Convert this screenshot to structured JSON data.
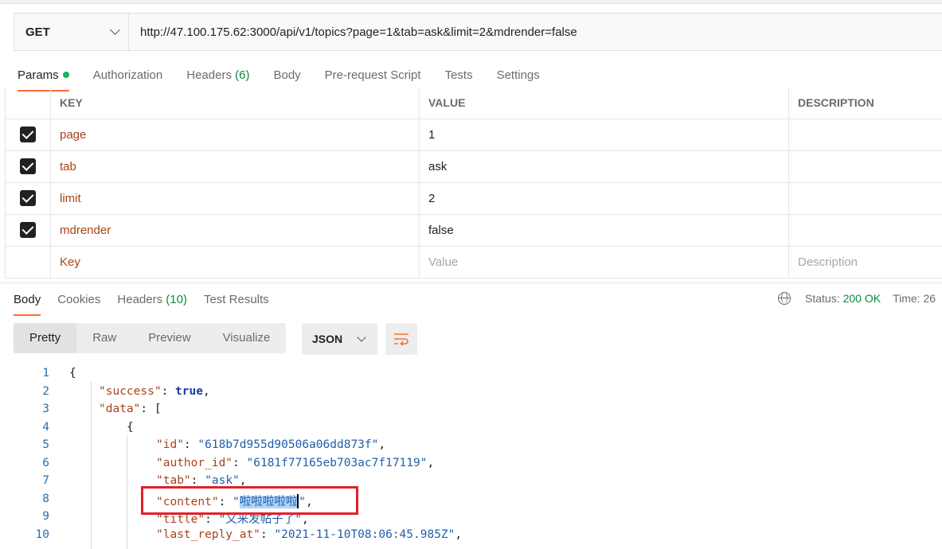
{
  "request": {
    "method": "GET",
    "url": "http://47.100.175.62:3000/api/v1/topics?page=1&tab=ask&limit=2&mdrender=false"
  },
  "request_tabs": {
    "params": "Params",
    "authorization": "Authorization",
    "headers": "Headers",
    "headers_count": "(6)",
    "body": "Body",
    "prerequest": "Pre-request Script",
    "tests": "Tests",
    "settings": "Settings"
  },
  "params_table": {
    "headers": {
      "key": "KEY",
      "value": "VALUE",
      "description": "DESCRIPTION"
    },
    "rows": [
      {
        "key": "page",
        "value": "1",
        "checked": true
      },
      {
        "key": "tab",
        "value": "ask",
        "checked": true
      },
      {
        "key": "limit",
        "value": "2",
        "checked": true
      },
      {
        "key": "mdrender",
        "value": "false",
        "checked": true
      }
    ],
    "placeholders": {
      "key": "Key",
      "value": "Value",
      "description": "Description"
    }
  },
  "response_tabs": {
    "body": "Body",
    "cookies": "Cookies",
    "headers": "Headers",
    "headers_count": "(10)",
    "test_results": "Test Results"
  },
  "status": {
    "status_label": "Status:",
    "status_value": "200 OK",
    "time_label": "Time: 26"
  },
  "view_modes": {
    "pretty": "Pretty",
    "raw": "Raw",
    "preview": "Preview",
    "visualize": "Visualize",
    "format": "JSON"
  },
  "code": {
    "line_numbers": [
      "1",
      "2",
      "3",
      "4",
      "5",
      "6",
      "7",
      "8",
      "9",
      "10"
    ],
    "l1": "{",
    "l2_key": "\"success\"",
    "l2_val": "true",
    "l3_key": "\"data\"",
    "l3_val": "[",
    "l4": "{",
    "l5_key": "\"id\"",
    "l5_val": "\"618b7d955d90506a06dd873f\"",
    "l6_key": "\"author_id\"",
    "l6_val": "\"6181f77165eb703ac7f17119\"",
    "l7_key": "\"tab\"",
    "l7_val": "\"ask\"",
    "l8_key": "\"content\"",
    "l8_val": "啦啦啦啦啦",
    "l9_key": "\"title\"",
    "l9_val": "\"又来发帖子了\"",
    "l10_key": "\"last_reply_at\"",
    "l10_val": "\"2021-11-10T08:06:45.985Z\""
  },
  "colors": {
    "accent": "#ff6c37",
    "status_ok": "#0a8a3c",
    "annotation_box": "#e32028",
    "selection": "#b3d4fc"
  }
}
